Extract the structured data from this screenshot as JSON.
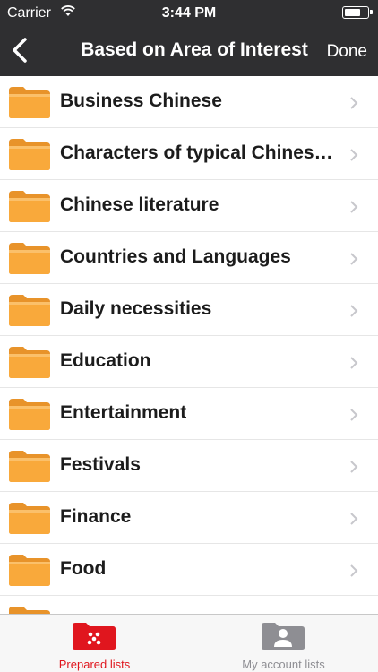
{
  "status": {
    "carrier": "Carrier",
    "time": "3:44 PM"
  },
  "nav": {
    "title": "Based on Area of Interest",
    "done_label": "Done"
  },
  "list": {
    "items": [
      {
        "label": "Business Chinese"
      },
      {
        "label": "Characters of typical Chinese..."
      },
      {
        "label": "Chinese literature"
      },
      {
        "label": "Countries and Languages"
      },
      {
        "label": "Daily necessities"
      },
      {
        "label": "Education"
      },
      {
        "label": "Entertainment"
      },
      {
        "label": "Festivals"
      },
      {
        "label": "Finance"
      },
      {
        "label": "Food"
      }
    ]
  },
  "tabs": [
    {
      "label": "Prepared lists",
      "icon": "red-folder-icon",
      "active": true
    },
    {
      "label": "My account lists",
      "icon": "user-folder-icon",
      "active": false
    }
  ],
  "colors": {
    "accent": "#e0161e",
    "navbar": "#2f2f31",
    "folder": "#f7a83a"
  }
}
